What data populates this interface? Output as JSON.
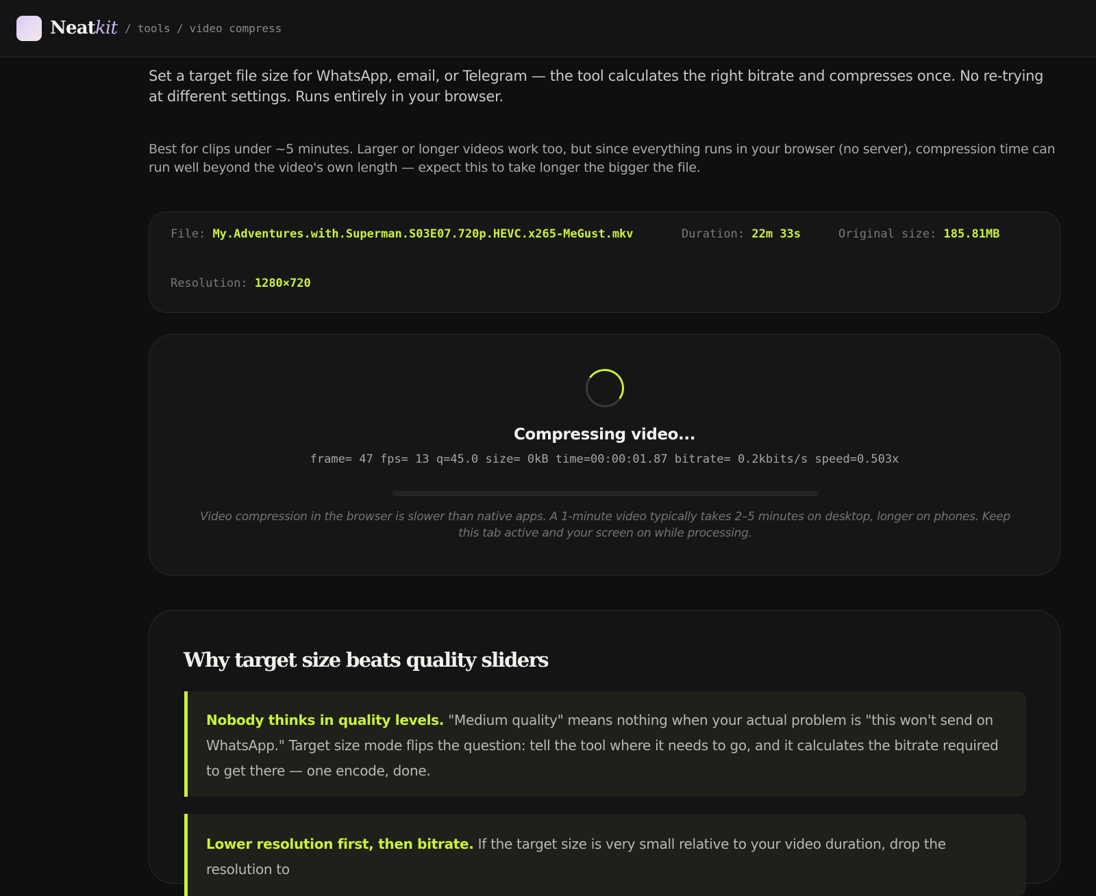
{
  "header": {
    "brand_main": "Neat",
    "brand_accent": "kit",
    "breadcrumb": [
      "/",
      "tools",
      "/",
      "video compress"
    ]
  },
  "intro": {
    "lead": "Set a target file size for WhatsApp, email, or Telegram — the tool calculates the right bitrate and compresses once. No re-trying at different settings. Runs entirely in your browser.",
    "note": "Best for clips under ~5 minutes. Larger or longer videos work too, but since everything runs in your browser (no server), compression time can run well beyond the video's own length — expect this to take longer the bigger the file."
  },
  "file": {
    "file_label": "File:",
    "file_value": "My.Adventures.with.Superman.S03E07.720p.HEVC.x265-MeGust.mkv",
    "duration_label": "Duration:",
    "duration_value": "22m 33s",
    "size_label": "Original size:",
    "size_value": "185.81MB",
    "resolution_label": "Resolution:",
    "resolution_value": "1280×720"
  },
  "progress": {
    "title": "Compressing video...",
    "log": "frame= 47 fps= 13 q=45.0 size= 0kB time=00:00:01.87 bitrate= 0.2kbits/s speed=0.503x",
    "fraction": 0,
    "hint": "Video compression in the browser is slower than native apps. A 1-minute video typically takes 2–5 minutes on desktop, longer on phones. Keep this tab active and your screen on while processing."
  },
  "info": {
    "title": "Why target size beats quality sliders",
    "callouts": [
      {
        "lead": "Nobody thinks in quality levels.",
        "text": " \"Medium quality\" means nothing when your actual problem is \"this won't send on WhatsApp.\" Target size mode flips the question: tell the tool where it needs to go, and it calculates the bitrate required to get there — one encode, done."
      },
      {
        "lead": "Lower resolution first, then bitrate.",
        "text": " If the target size is very small relative to your video duration, drop the resolution to"
      }
    ]
  },
  "colors": {
    "accent": "#c9f23a",
    "background": "#0f0f10",
    "card": "#161617"
  }
}
